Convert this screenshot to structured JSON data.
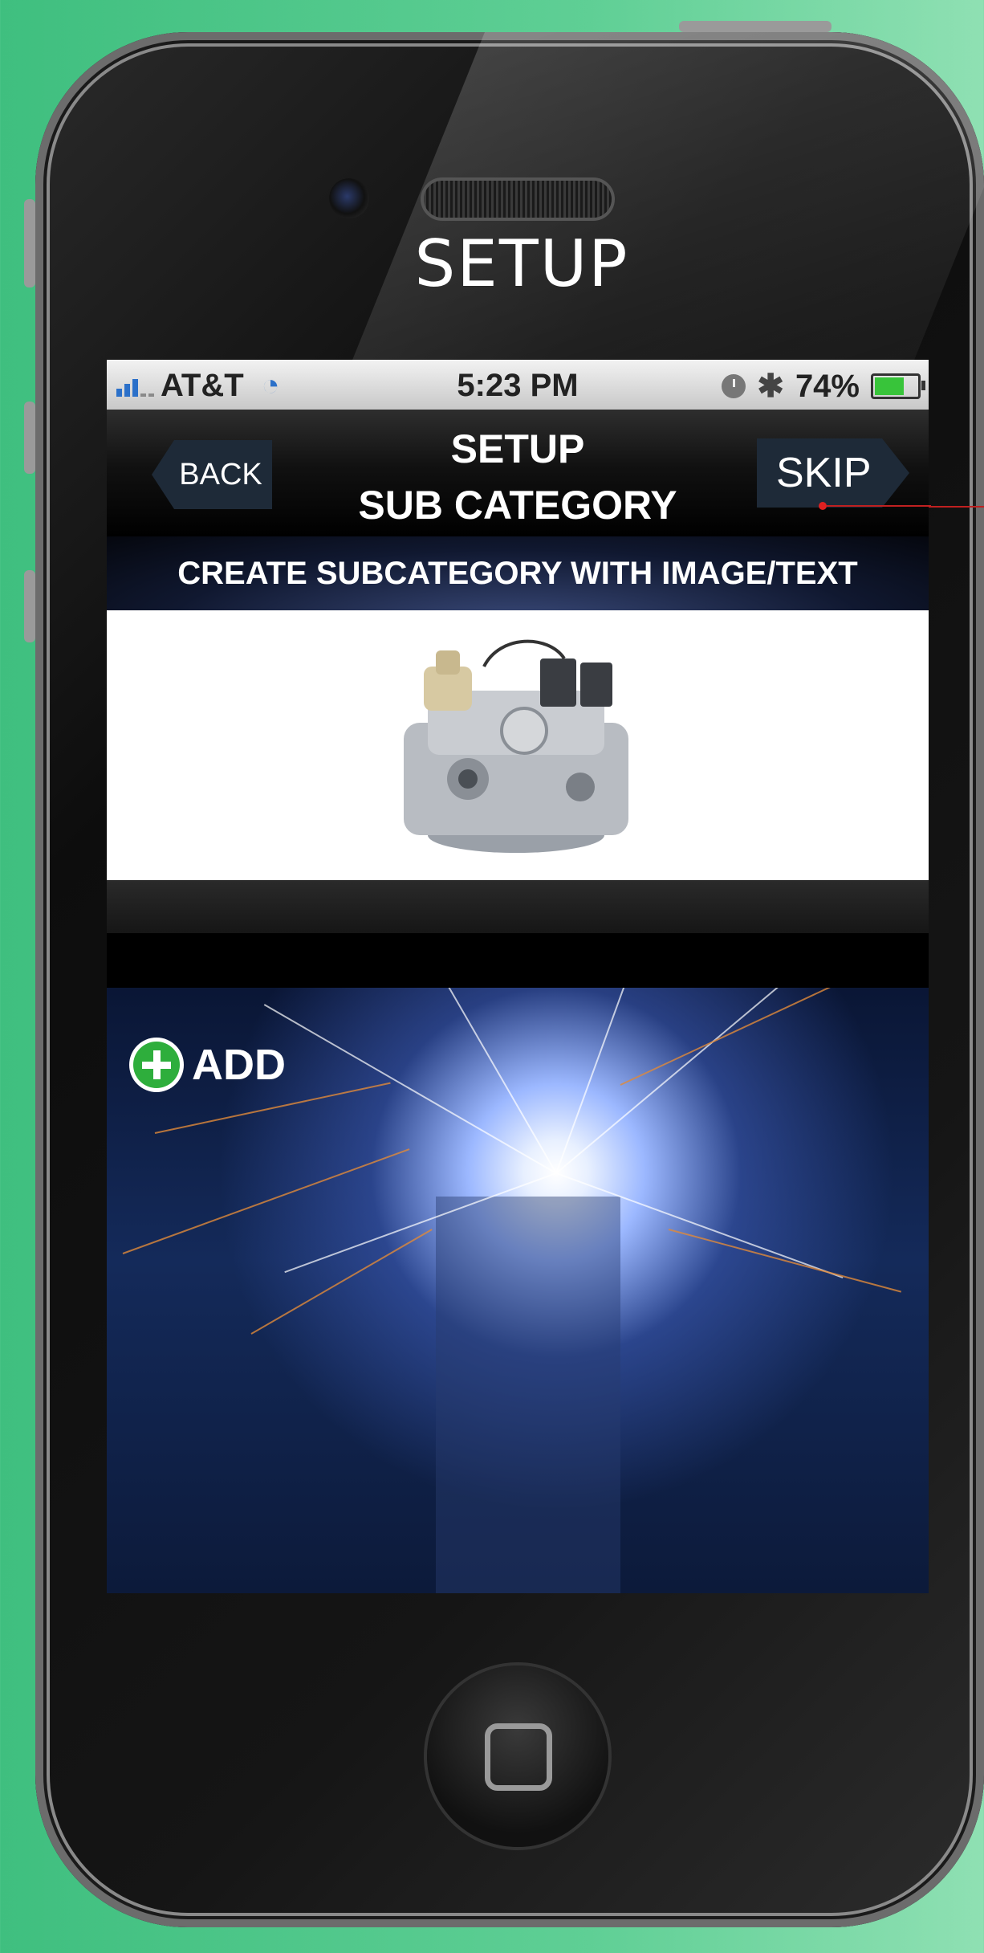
{
  "phone": {
    "title": "SETUP"
  },
  "status_bar": {
    "carrier": "AT&T",
    "time": "5:23 PM",
    "battery": "74%",
    "battery_level": 0.74
  },
  "nav": {
    "back_label": "BACK",
    "title_line1": "SETUP",
    "title_line2": "SUB CATEGORY",
    "skip_label": "SKIP"
  },
  "banner": {
    "text": "CREATE SUBCATEGORY WITH IMAGE/TEXT"
  },
  "add": {
    "label": "ADD"
  },
  "colors": {
    "accent_green": "#2eae3c",
    "nav_button": "#1e2a38",
    "annotation": "#c02020"
  },
  "icons": [
    "signal-icon",
    "wifi-icon",
    "clock-icon",
    "bluetooth-icon",
    "battery-icon",
    "plus-icon",
    "home-button-icon"
  ]
}
